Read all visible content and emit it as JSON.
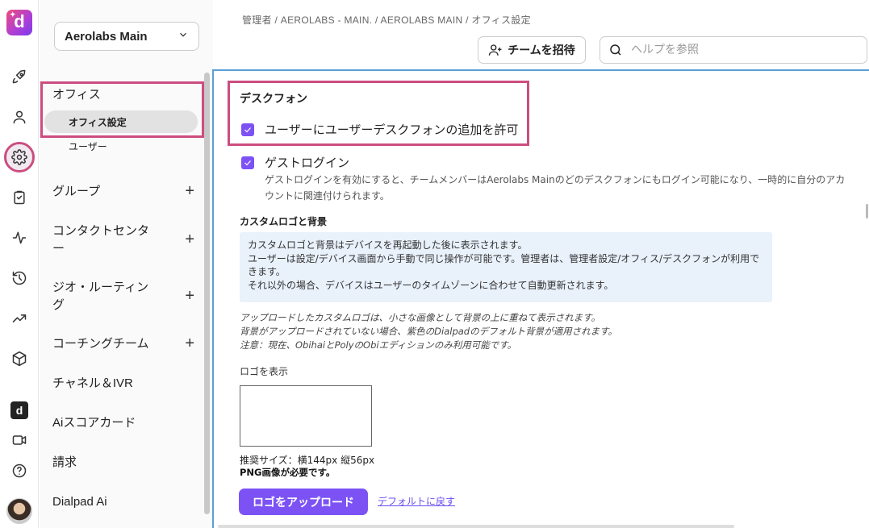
{
  "rail": {
    "logo_letter": "d",
    "items": [
      "rocket-icon",
      "person-icon",
      "gear-icon",
      "clipboard-icon",
      "activity-icon",
      "history-icon",
      "trending-icon",
      "cube-icon",
      "dialpad-app-icon",
      "video-icon",
      "help-icon"
    ],
    "active": "gear-icon"
  },
  "sidebar": {
    "org_select": "Aerolabs Main",
    "office_header": "オフィス",
    "office_items": [
      "オフィス設定",
      "ユーザー"
    ],
    "sections": [
      {
        "label": "グループ",
        "expandable": true
      },
      {
        "label": "コンタクトセンター",
        "expandable": true
      },
      {
        "label": "ジオ・ルーティング",
        "expandable": true
      },
      {
        "label": "コーチングチーム",
        "expandable": true
      },
      {
        "label": "チャネル＆IVR",
        "expandable": false
      },
      {
        "label": "Aiスコアカード",
        "expandable": false
      },
      {
        "label": "請求",
        "expandable": false
      },
      {
        "label": "Dialpad Ai",
        "expandable": false
      }
    ]
  },
  "header": {
    "breadcrumb": "管理者 / AEROLABS - MAIN. / AEROLABS MAIN / オフィス設定",
    "invite_label": "チームを招待",
    "search_placeholder": "ヘルプを参照"
  },
  "main": {
    "section_title": "デスクフォン",
    "allow_user_desk_phone": {
      "label": "ユーザーにユーザーデスクフォンの追加を許可",
      "checked": true
    },
    "guest_login": {
      "label": "ゲストログイン",
      "checked": true,
      "description": "ゲストログインを有効にすると、チームメンバーはAerolabs Mainのどのデスクフォンにもログイン可能になり、一時的に自分のアカウントに関連付けられます。"
    },
    "custom_logo_title": "カスタムロゴと背景",
    "info_lines": [
      "カスタムロゴと背景はデバイスを再起動した後に表示されます。",
      "ユーザーは設定/デバイス画面から手動で同じ操作が可能です。管理者は、管理者設定/オフィス/デスクフォンが利用できます。",
      "それ以外の場合、デバイスはユーザーのタイムゾーンに合わせて自動更新されます。"
    ],
    "notes": [
      "アップロードしたカスタムロゴは、小さな画像として背景の上に重ねて表示されます。",
      "背景がアップロードされていない場合、紫色のDialpadのデフォルト背景が適用されます。",
      "注意：現在、ObihaiとPolyのObiエディションのみ利用可能です。"
    ],
    "logo_label": "ロゴを表示",
    "size_note": "推奨サイズ：横144px 縦56px",
    "png_note": "PNG画像が必要です。",
    "upload_label": "ロゴをアップロード",
    "reset_label": "デフォルトに戻す"
  },
  "colors": {
    "accent": "#7c52f4",
    "highlight": "#cc4d80",
    "info_bg": "#e9f1fb"
  }
}
